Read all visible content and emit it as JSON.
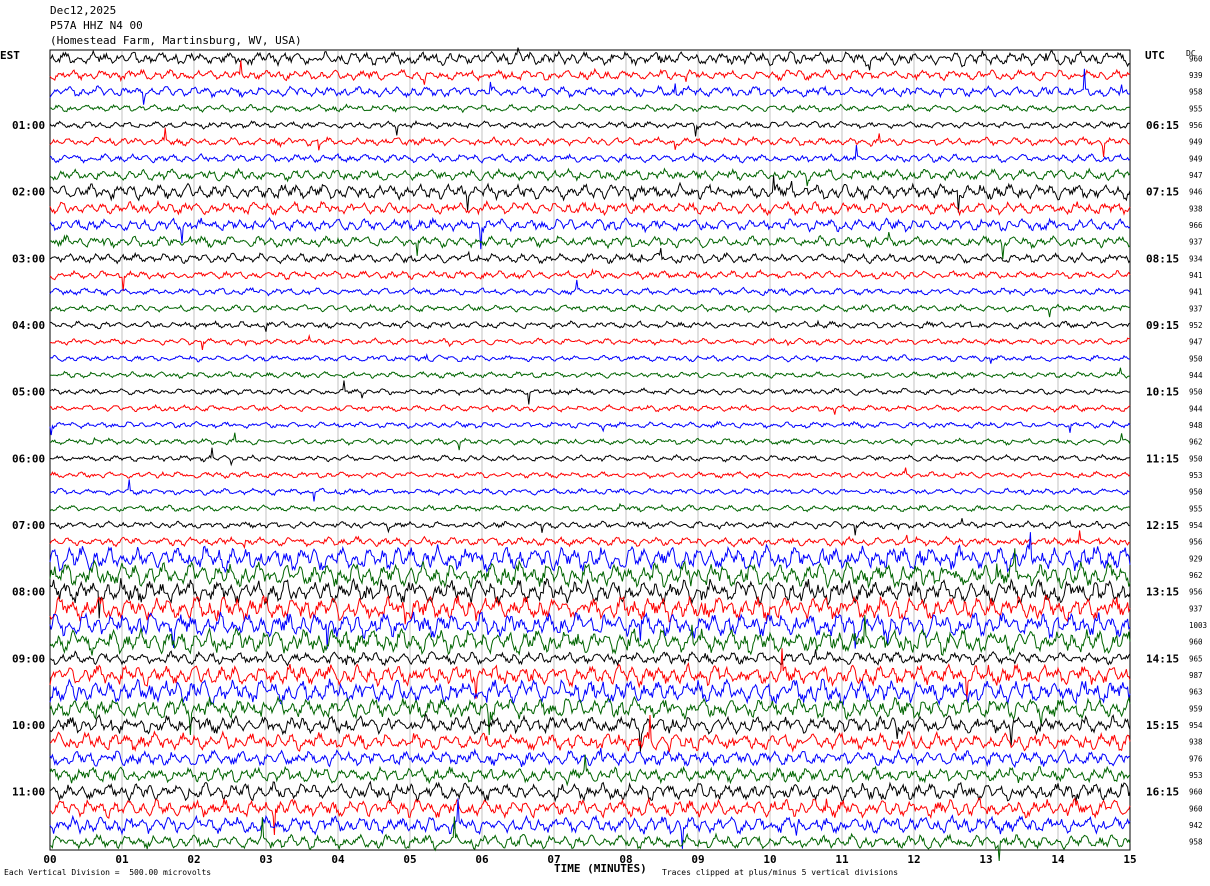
{
  "header": {
    "date": "Dec12,2025",
    "station": "P57A HHZ N4 00",
    "location": "(Homestead Farm, Martinsburg, WV, USA)"
  },
  "footer": {
    "vertical_division": "Each Vertical Division =  500.00 microvolts",
    "clip_note": "Traces clipped at plus/minus 5 vertical divisions",
    "x_title": "TIME (MINUTES)"
  },
  "chart_data": {
    "type": "line",
    "title": "",
    "xlabel": "TIME (MINUTES)",
    "ylabel_left": "EST",
    "ylabel_right": "UTC",
    "dc_label": "DC",
    "xlim": [
      0,
      15
    ],
    "x_ticks": [
      "00",
      "01",
      "02",
      "03",
      "04",
      "05",
      "06",
      "07",
      "08",
      "09",
      "10",
      "11",
      "12",
      "13",
      "14",
      "15"
    ],
    "est_ticks": [
      "01:00",
      "02:00",
      "03:00",
      "04:00",
      "05:00",
      "06:00",
      "07:00",
      "08:00",
      "09:00",
      "10:00",
      "11:00"
    ],
    "utc_ticks": [
      "06:15",
      "07:15",
      "08:15",
      "09:15",
      "10:15",
      "11:15",
      "12:15",
      "13:15",
      "14:15",
      "15:15",
      "16:15"
    ],
    "trace_colors": [
      "#000000",
      "#ff0000",
      "#0000ff",
      "#006400"
    ],
    "grid": true,
    "dc_offsets": [
      960,
      939,
      958,
      955,
      956,
      949,
      949,
      947,
      946,
      938,
      966,
      937,
      934,
      941,
      941,
      937,
      952,
      947,
      950,
      944,
      950,
      944,
      948,
      962,
      950,
      953,
      950,
      955,
      954,
      956,
      929,
      962,
      956,
      937,
      1003,
      960,
      965,
      987,
      963,
      959,
      954,
      938,
      976,
      953,
      960,
      960,
      942,
      958
    ],
    "trace_amplitude_levels": [
      2.0,
      1.5,
      1.5,
      1.0,
      1.0,
      1.2,
      1.2,
      1.6,
      2.2,
      1.8,
      1.8,
      1.6,
      1.4,
      1.2,
      1.0,
      1.0,
      1.0,
      0.9,
      0.9,
      0.9,
      0.9,
      0.9,
      0.9,
      0.9,
      0.9,
      0.9,
      0.9,
      0.9,
      1.0,
      1.3,
      3.5,
      3.5,
      3.5,
      3.5,
      3.5,
      3.5,
      1.8,
      3.0,
      3.5,
      3.0,
      2.5,
      2.5,
      2.2,
      2.2,
      2.5,
      2.5,
      2.5,
      2.0
    ]
  }
}
